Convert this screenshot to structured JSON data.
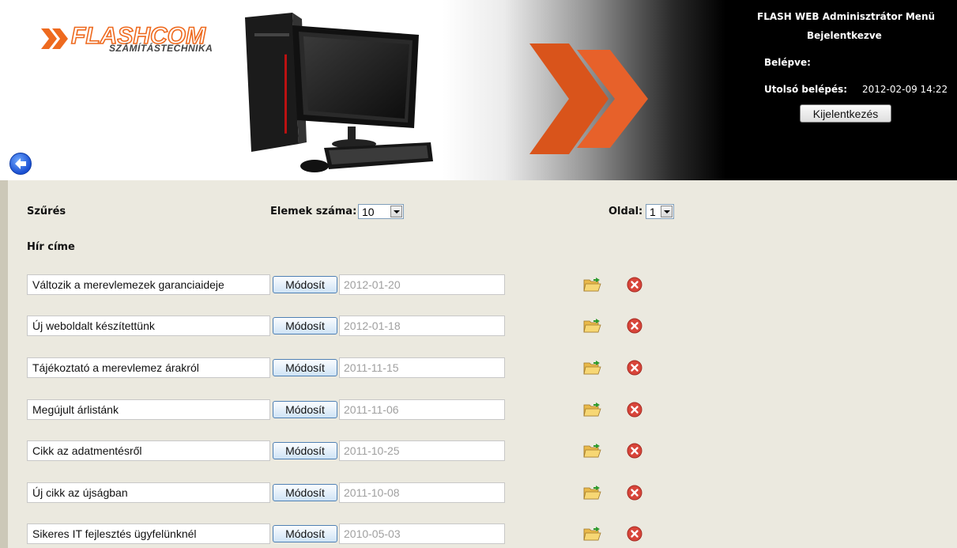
{
  "header": {
    "logo_main_1": "FLASH",
    "logo_main_2": "COM",
    "logo_sub": "SZÁMÍTÁSTECHNIKA"
  },
  "admin": {
    "title": "FLASH WEB Adminisztrátor Menü",
    "status": "Bejelentkezve",
    "login_label": "Belépve:",
    "last_login_label": "Utolsó belépés:",
    "last_login_value": "2012-02-09 14:22",
    "logout_label": "Kijelentkezés"
  },
  "filter": {
    "label": "Szűrés",
    "items_count_label": "Elemek száma:",
    "items_count_value": "10",
    "page_label": "Oldal:",
    "page_value": "1"
  },
  "list": {
    "column_title": "Hír címe",
    "modify_label": "Módosít",
    "rows": [
      {
        "title": "Változik a merevlemezek garanciaideje",
        "date": "2012-01-20"
      },
      {
        "title": "Új weboldalt készítettünk",
        "date": "2012-01-18"
      },
      {
        "title": "Tájékoztató a merevlemez árakról",
        "date": "2011-11-15"
      },
      {
        "title": "Megújult árlistánk",
        "date": "2011-11-06"
      },
      {
        "title": "Cikk az adatmentésről",
        "date": "2011-10-25"
      },
      {
        "title": "Új cikk az újságban",
        "date": "2011-10-08"
      },
      {
        "title": "Sikeres IT fejlesztés ügyfelünknél",
        "date": "2010-05-03"
      }
    ]
  },
  "icons": {
    "back": "arrow-left-circle",
    "open": "folder-open",
    "delete": "red-x-circle"
  },
  "colors": {
    "brand_orange": "#ee6a1f",
    "content_bg": "#ebe9df",
    "button_border": "#4f80b4"
  }
}
